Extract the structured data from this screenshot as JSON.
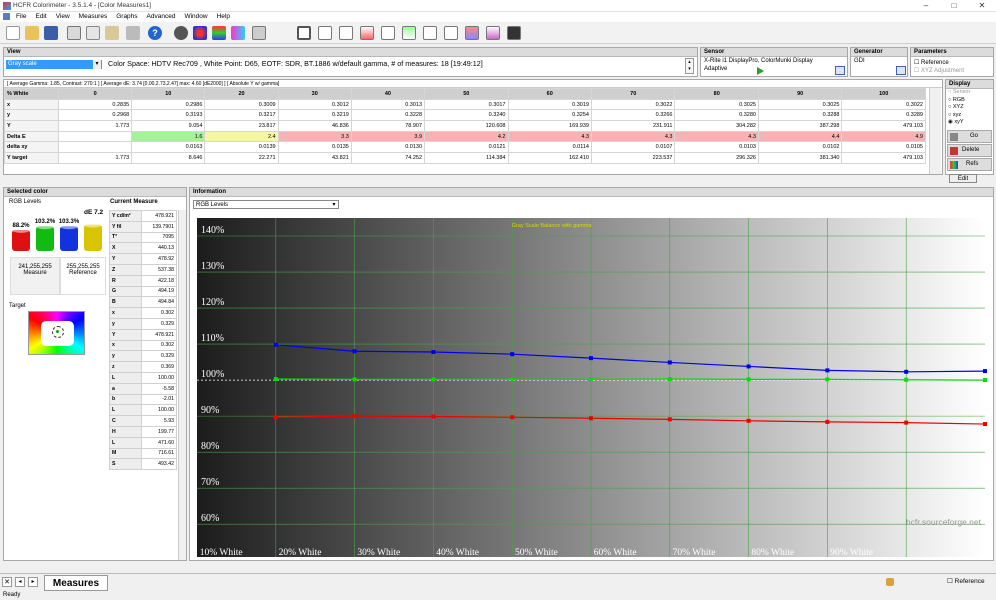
{
  "window": {
    "title": "HCFR Colorimeter - 3.5.1.4 - [Color Measures1]",
    "min": "–",
    "max": "□",
    "close": "✕"
  },
  "menu": [
    "File",
    "Edit",
    "View",
    "Measures",
    "Graphs",
    "Advanced",
    "Window",
    "Help"
  ],
  "view": {
    "header": "View",
    "dropdown": "Gray scale",
    "info": "Color Space: HDTV Rec709 , White Point: D65, EOTF:  SDR, BT.1886 w/default gamma, # of measures: 18 [19:49:12]",
    "stats": "[ Average Gamma: 1.85, Contrast: 270:1 ]  [ Average dE: 3.74 [0.00,2.73,2.47] max: 4.60 [dE2000] ]  [ Absolute Y w/ gamma]"
  },
  "sensor": {
    "header": "Sensor",
    "name": "X-Rite i1 DisplayPro, ColorMunki Display",
    "mode": "Adaptive"
  },
  "generator": {
    "header": "Generator",
    "name": "GDI"
  },
  "parameters": {
    "header": "Parameters",
    "reference": "Reference",
    "xyz_adjust": "XYZ Adjustment"
  },
  "display": {
    "header": "Display",
    "options": [
      "Sensor",
      "RGB",
      "XYZ",
      "xyz",
      "xyY"
    ],
    "selected": "xyY"
  },
  "side_buttons": {
    "go": "Go",
    "delete": "Delete",
    "refs": "Refs",
    "edit": "Edit"
  },
  "table": {
    "columns": [
      "% White",
      "0",
      "10",
      "20",
      "30",
      "40",
      "50",
      "60",
      "70",
      "80",
      "90",
      "100"
    ],
    "rows": [
      {
        "label": "x",
        "values": [
          "0.2835",
          "0.2986",
          "0.3009",
          "0.3012",
          "0.3013",
          "0.3017",
          "0.3019",
          "0.3022",
          "0.3025",
          "0.3025",
          "0.3022"
        ]
      },
      {
        "label": "y",
        "values": [
          "0.2968",
          "0.3193",
          "0.3217",
          "0.3219",
          "0.3228",
          "0.3240",
          "0.3254",
          "0.3266",
          "0.3280",
          "0.3288",
          "0.3289"
        ]
      },
      {
        "label": "Y",
        "values": [
          "1.773",
          "9.054",
          "23.817",
          "46.836",
          "78.907",
          "120.608",
          "169.939",
          "231.911",
          "304.282",
          "387.298",
          "479.103"
        ]
      },
      {
        "label": "Delta E",
        "values": [
          "",
          "1.6",
          "2.4",
          "3.3",
          "3.9",
          "4.2",
          "4.3",
          "4.3",
          "4.3",
          "4.4",
          "4.9"
        ]
      },
      {
        "label": "delta xy",
        "values": [
          "",
          "0.0163",
          "0.0139",
          "0.0135",
          "0.0130",
          "0.0121",
          "0.0114",
          "0.0107",
          "0.0103",
          "0.0102",
          "0.0105"
        ]
      },
      {
        "label": "Y target",
        "values": [
          "1.773",
          "8.646",
          "22.271",
          "43.821",
          "74.252",
          "114.384",
          "162.410",
          "223.537",
          "296.326",
          "381.340",
          "479.103"
        ]
      }
    ]
  },
  "selected_color": {
    "header": "Selected color",
    "sublabel": "RGB Levels",
    "de": "dE 7.2",
    "bars": [
      {
        "label": "88.2%",
        "color": "#dd1111",
        "level": 0.882
      },
      {
        "label": "103.2%",
        "color": "#11bb11",
        "level": 1.032
      },
      {
        "label": "103.3%",
        "color": "#1133dd",
        "level": 1.033
      }
    ],
    "measure_value": "241,255,255",
    "measure_label": "Measure",
    "reference_value": "255,255,255",
    "reference_label": "Reference",
    "target_label": "Target"
  },
  "current_measure": {
    "header": "Current Measure",
    "rows": [
      [
        "Y cd/m²",
        "478.921"
      ],
      [
        "Y fil",
        "139.7901"
      ],
      [
        "T°",
        "7095"
      ],
      [
        "X",
        "440.13"
      ],
      [
        "Y",
        "478.92"
      ],
      [
        "Z",
        "537.38"
      ],
      [
        "R",
        "422.18"
      ],
      [
        "G",
        "494.19"
      ],
      [
        "B",
        "494.84"
      ],
      [
        "x",
        "0.302"
      ],
      [
        "y",
        "0.329"
      ],
      [
        "Y",
        "478.921"
      ],
      [
        "x",
        "0.302"
      ],
      [
        "y",
        "0.329"
      ],
      [
        "z",
        "0.369"
      ],
      [
        "L",
        "100.00"
      ],
      [
        "a",
        "-5.58"
      ],
      [
        "b",
        "-2.01"
      ],
      [
        "L",
        "100.00"
      ],
      [
        "C",
        "5.93"
      ],
      [
        "H",
        "199.77"
      ],
      [
        "L",
        "471.60"
      ],
      [
        "M",
        "716.61"
      ],
      [
        "S",
        "493.42"
      ]
    ]
  },
  "information": {
    "header": "Information",
    "dropdown": "RGB Levels"
  },
  "chart_data": {
    "type": "line",
    "title": "Gray Scale Balance with gamma",
    "watermark": "hcfr.sourceforge.net",
    "x": [
      10,
      20,
      30,
      40,
      50,
      60,
      70,
      80,
      90,
      100
    ],
    "x_tick_labels": [
      "10% White",
      "20% White",
      "30% White",
      "40% White",
      "50% White",
      "60% White",
      "70% White",
      "80% White",
      "90% White"
    ],
    "y_tick_labels": [
      "140%",
      "130%",
      "120%",
      "110%",
      "100%",
      "90%",
      "80%",
      "70%",
      "60%"
    ],
    "ylim": [
      57,
      145
    ],
    "series": [
      {
        "color": "#0000ee",
        "values": [
          109.8,
          108.0,
          107.8,
          107.2,
          106.1,
          104.9,
          103.8,
          102.7,
          102.3,
          102.5
        ]
      },
      {
        "color": "#00dd00",
        "values": [
          100.3,
          100.2,
          100.2,
          100.2,
          100.2,
          100.3,
          100.2,
          100.2,
          100.1,
          100.0
        ]
      },
      {
        "color": "#ee0000",
        "values": [
          89.7,
          90.0,
          89.9,
          89.7,
          89.4,
          89.1,
          88.7,
          88.4,
          88.2,
          87.8
        ]
      }
    ]
  },
  "bottom_tab": "Measures",
  "bottom_reference": "Reference",
  "status": "Ready"
}
